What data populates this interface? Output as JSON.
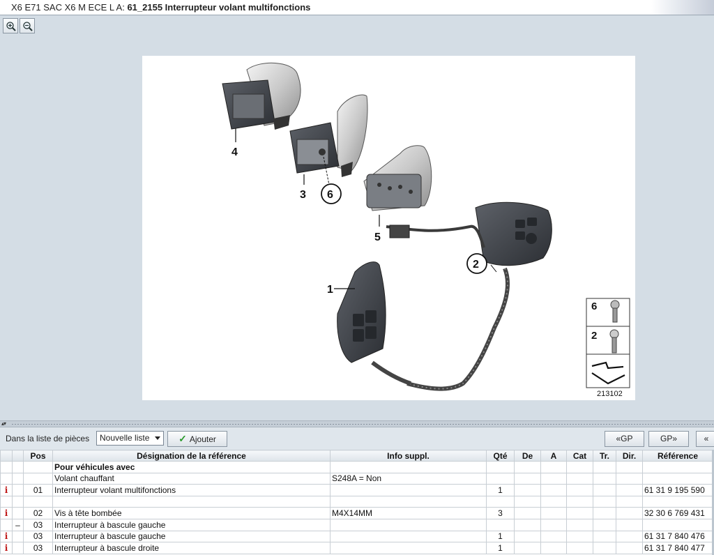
{
  "title": {
    "prefix": "X6 E71 SAC X6 M ECE  L A: ",
    "bold": "61_2155 Interrupteur volant multifonctions"
  },
  "zoom": {
    "zoom_in_icon": "zoom-in-icon",
    "zoom_out_icon": "zoom-out-icon"
  },
  "diagram": {
    "callouts": [
      "4",
      "3",
      "6",
      "5",
      "2",
      "1"
    ],
    "hardware_legend": [
      "6",
      "2"
    ],
    "figure_number": "213102"
  },
  "toolbar": {
    "list_label": "Dans la liste de pièces",
    "list_select_value": "Nouvelle liste",
    "add_label": "Ajouter",
    "prev_gp_label": "«GP",
    "next_gp_label": "GP»",
    "more_label": "«"
  },
  "table": {
    "headers": [
      "",
      "",
      "Pos",
      "Désignation de la référence",
      "Info suppl.",
      "Qté",
      "De",
      "A",
      "Cat",
      "Tr.",
      "Dir.",
      "Référence"
    ],
    "rows": [
      {
        "info": "",
        "mark": "",
        "pos": "",
        "desc": "Pour véhicules avec",
        "extra": "",
        "qty": "",
        "ref": "",
        "group": true
      },
      {
        "info": "",
        "mark": "",
        "pos": "",
        "desc": "Volant chauffant",
        "extra": "S248A = Non",
        "qty": "",
        "ref": ""
      },
      {
        "info": "i",
        "mark": "",
        "pos": "01",
        "desc": "Interrupteur volant multifonctions",
        "extra": "",
        "qty": "1",
        "ref": "61 31 9 195 590"
      },
      {
        "info": "",
        "mark": "",
        "pos": "",
        "desc": "",
        "extra": "",
        "qty": "",
        "ref": ""
      },
      {
        "info": "i",
        "mark": "",
        "pos": "02",
        "desc": "Vis à tête bombée",
        "extra": "M4X14MM",
        "qty": "3",
        "ref": "32 30 6 769 431"
      },
      {
        "info": "",
        "mark": "–",
        "pos": "03",
        "desc": "Interrupteur à bascule gauche",
        "extra": "",
        "qty": "",
        "ref": ""
      },
      {
        "info": "i",
        "mark": "",
        "pos": "03",
        "desc": "Interrupteur à bascule gauche",
        "extra": "",
        "qty": "1",
        "ref": "61 31 7 840 476"
      },
      {
        "info": "i",
        "mark": "",
        "pos": "03",
        "desc": "Interrupteur à bascule droite",
        "extra": "",
        "qty": "1",
        "ref": "61 31 7 840 477"
      }
    ]
  }
}
